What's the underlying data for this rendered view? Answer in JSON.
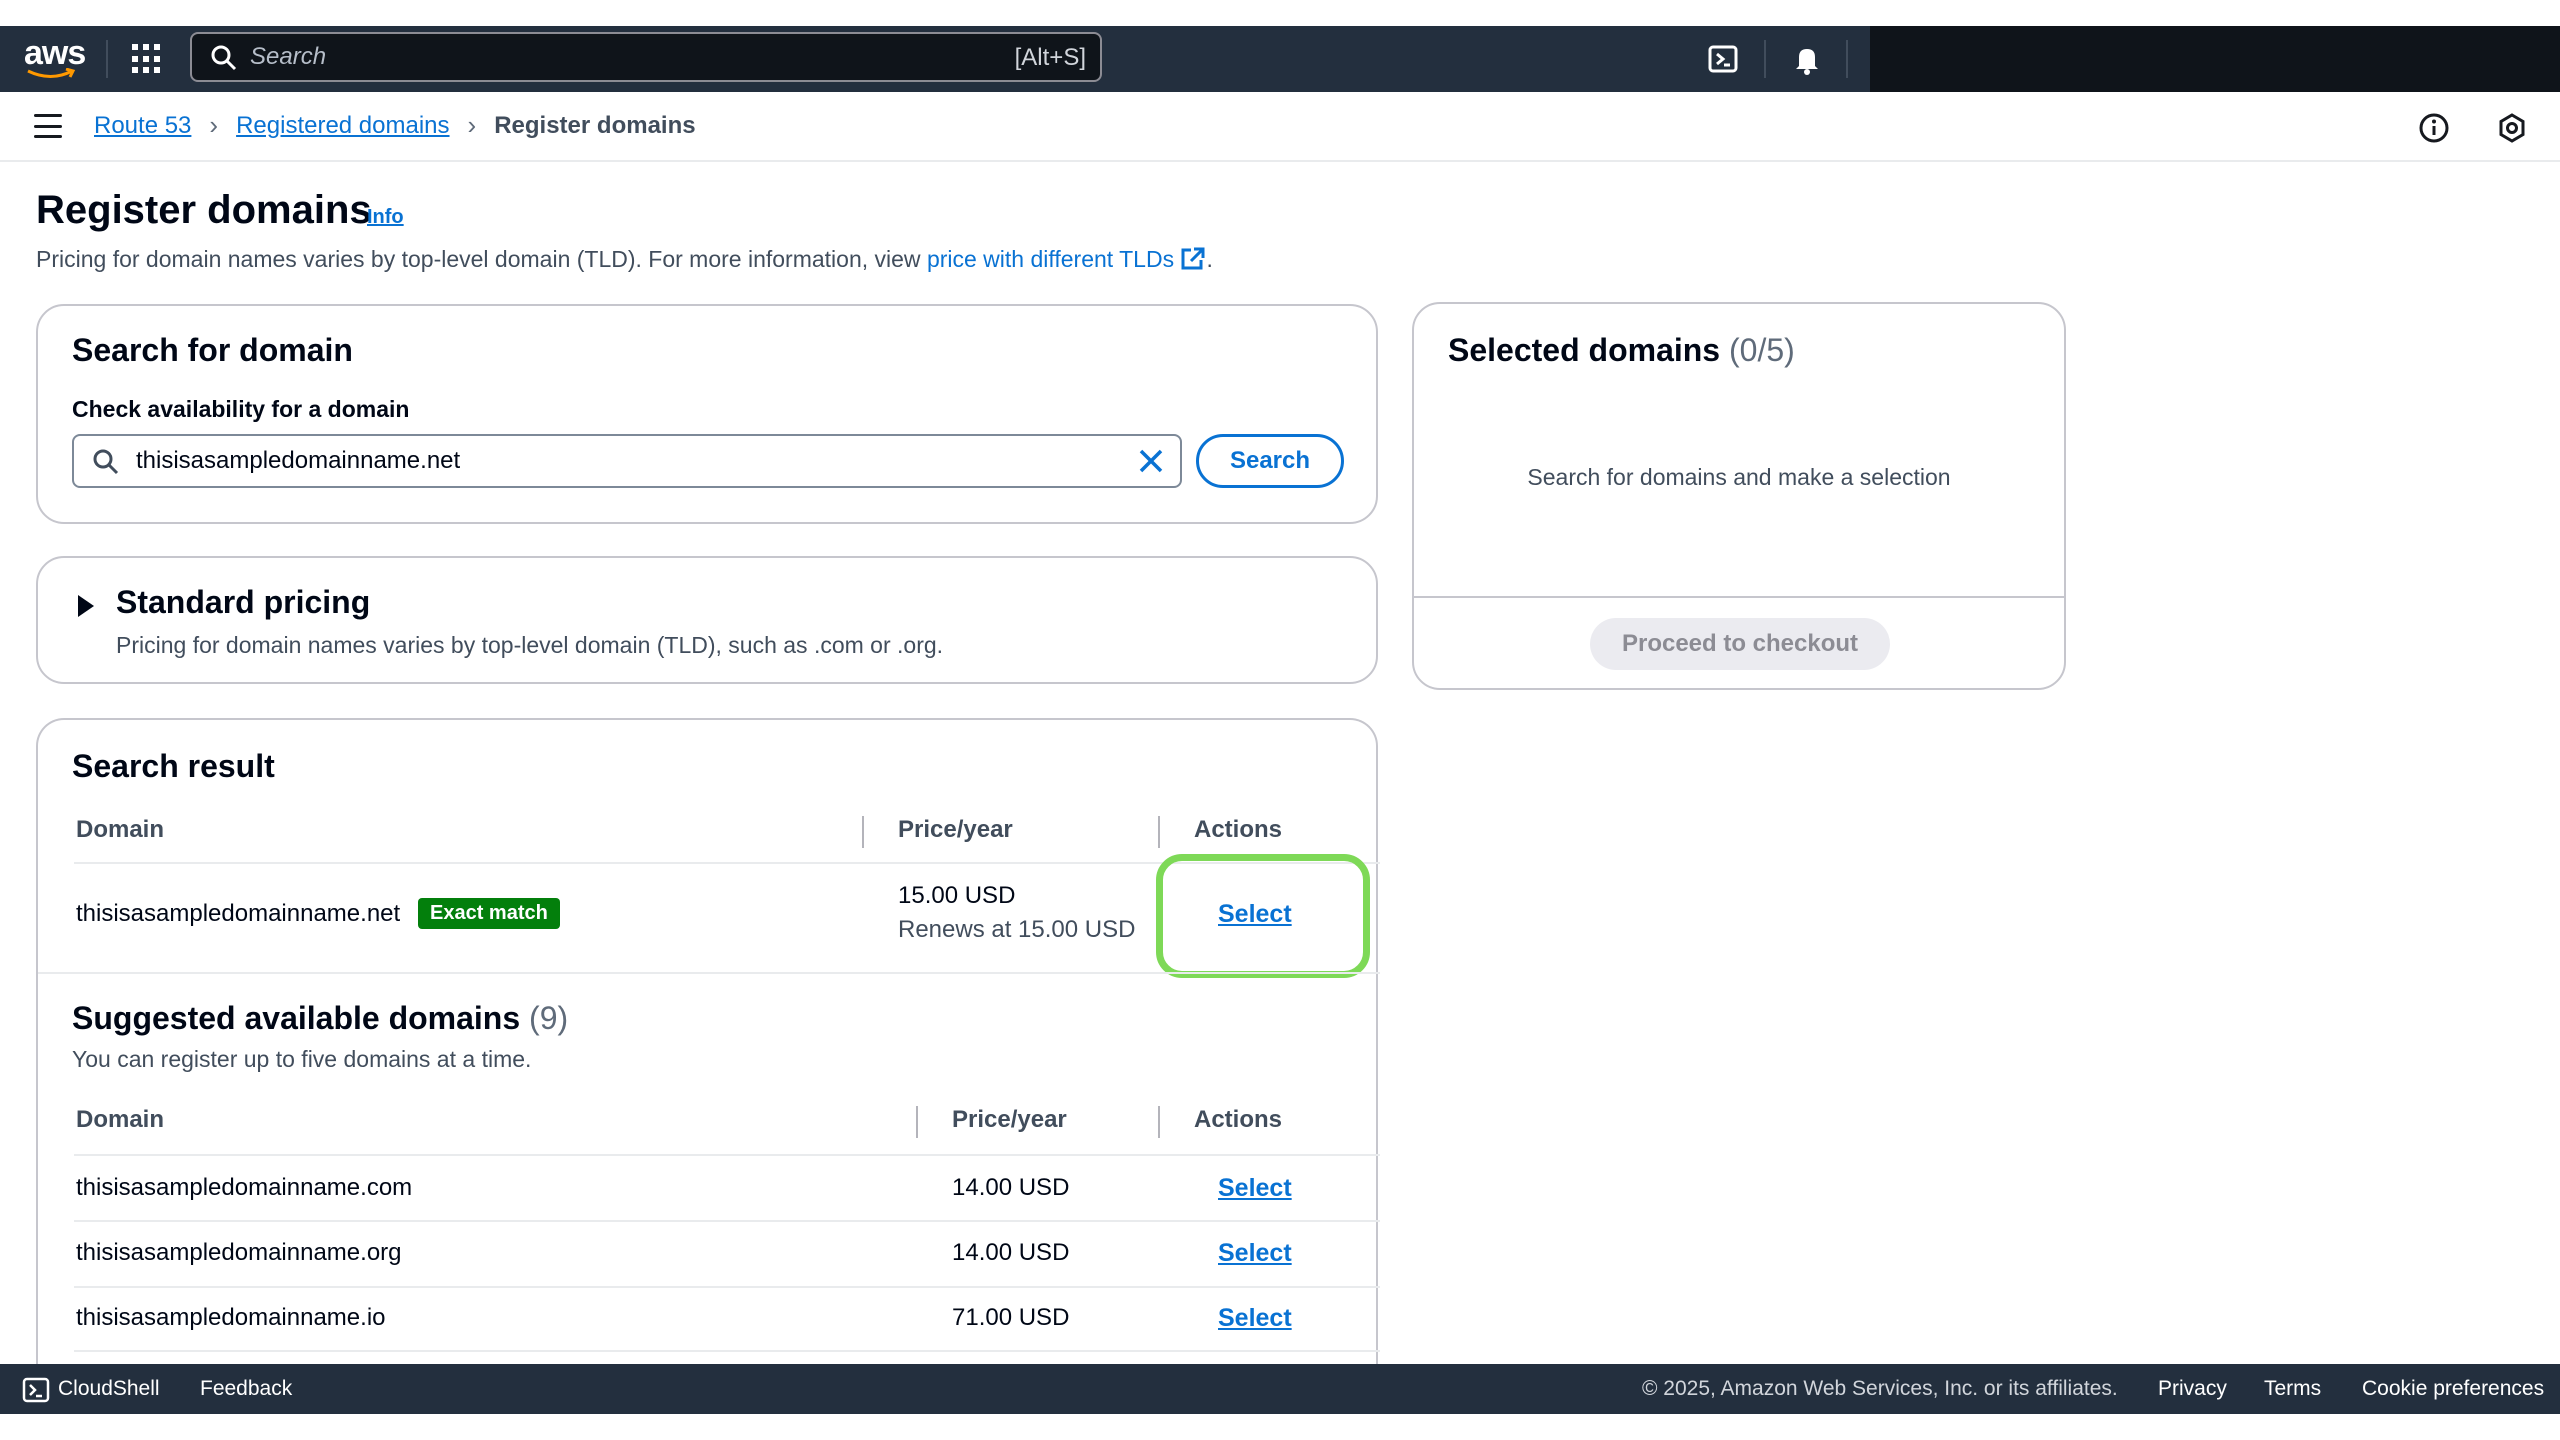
{
  "topnav": {
    "logo_text": "aws",
    "search_placeholder": "Search",
    "search_shortcut": "[Alt+S]",
    "icons": [
      "cloudshell-icon",
      "bell-icon"
    ]
  },
  "breadcrumb": {
    "items": [
      "Route 53",
      "Registered domains"
    ],
    "current": "Register domains"
  },
  "page": {
    "title": "Register domains",
    "info": "Info",
    "description": "Pricing for domain names varies by top-level domain (TLD). For more information, view ",
    "description_link": "price with different TLDs",
    "description_end": "."
  },
  "search_card": {
    "title": "Search for domain",
    "label": "Check availability for a domain",
    "value": "thisisasampledomainname.net",
    "button": "Search"
  },
  "pricing_card": {
    "title": "Standard pricing",
    "description": "Pricing for domain names varies by top-level domain (TLD), such as .com or .org."
  },
  "result_card": {
    "title": "Search result",
    "columns": [
      "Domain",
      "Price/year",
      "Actions"
    ],
    "row": {
      "domain": "thisisasampledomainname.net",
      "badge": "Exact match",
      "price": "15.00 USD",
      "renew": "Renews at 15.00 USD",
      "action": "Select"
    },
    "suggested_title": "Suggested available domains",
    "suggested_count": "(9)",
    "suggested_desc": "You can register up to five domains at a time.",
    "suggested_rows": [
      {
        "domain": "thisisasampledomainname.com",
        "price": "14.00 USD",
        "action": "Select"
      },
      {
        "domain": "thisisasampledomainname.org",
        "price": "14.00 USD",
        "action": "Select"
      },
      {
        "domain": "thisisasampledomainname.io",
        "price": "71.00 USD",
        "action": "Select"
      }
    ]
  },
  "selected_card": {
    "title": "Selected domains",
    "count": "(0/5)",
    "empty": "Search for domains and make a selection",
    "button": "Proceed to checkout"
  },
  "footer": {
    "cloudshell": "CloudShell",
    "feedback": "Feedback",
    "copyright": "© 2025, Amazon Web Services, Inc. or its affiliates.",
    "privacy": "Privacy",
    "terms": "Terms",
    "cookies": "Cookie preferences"
  },
  "colors": {
    "accent": "#0972d3",
    "nav_bg": "#232f3e",
    "success": "#037f0c",
    "highlight": "#7ed957"
  }
}
